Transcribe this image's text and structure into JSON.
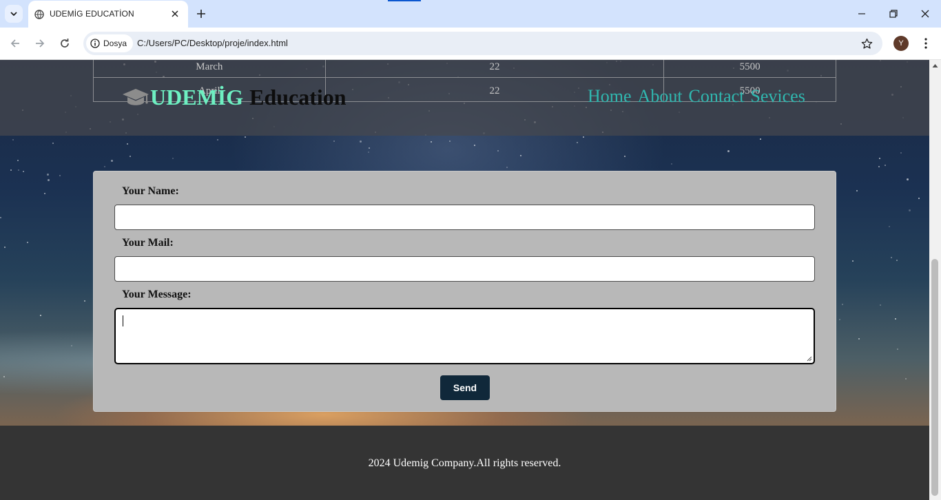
{
  "browser": {
    "tab_title": "UDEMİG EDUCATİON",
    "chip_label": "Dosya",
    "url": "C:/Users/PC/Desktop/proje/index.html",
    "avatar_letter": "Y"
  },
  "table": {
    "rows": [
      [
        "March",
        "22",
        "5500"
      ],
      [
        "April",
        "22",
        "5500"
      ]
    ]
  },
  "header": {
    "brand": "UDEMİG",
    "brand_rest": "Education",
    "nav": [
      "Home",
      "About",
      "Contact",
      "Sevices"
    ]
  },
  "form": {
    "name_label": "Your Name:",
    "mail_label": "Your Mail:",
    "message_label": "Your Message:",
    "name_value": "",
    "mail_value": "",
    "message_value": "",
    "send_label": "Send"
  },
  "footer": {
    "text": "2024 Udemig Company.All rights reserved."
  },
  "colors": {
    "brand": "#6ef0c2",
    "nav_link": "#30b8b0",
    "send_button": "#10283a",
    "footer_bg": "#343434"
  }
}
